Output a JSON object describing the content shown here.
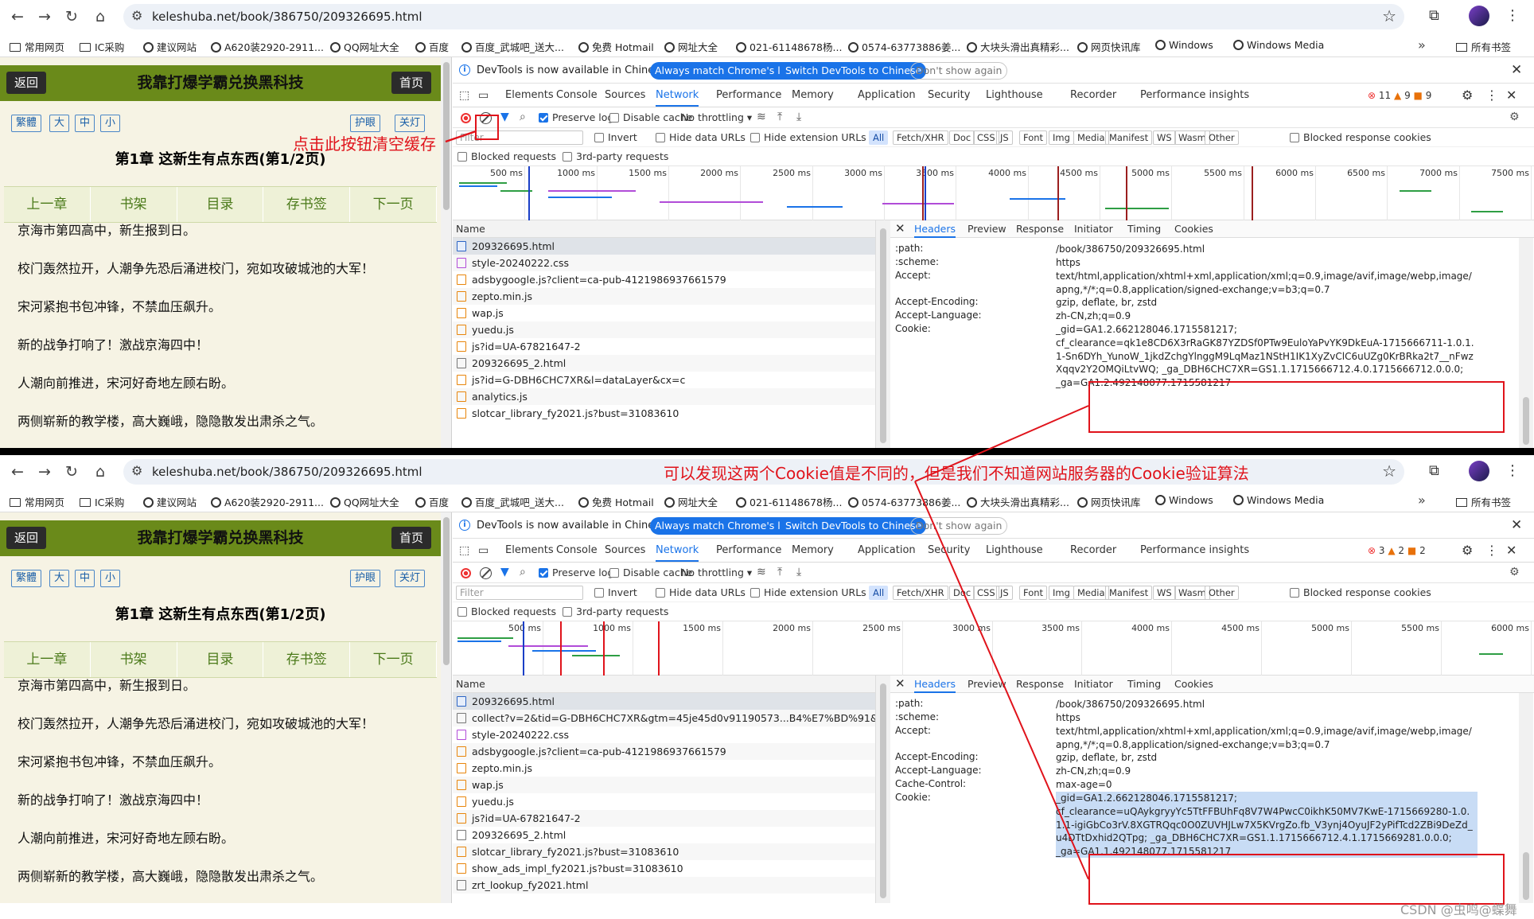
{
  "browser": {
    "url": "keleshuba.net/book/386750/209326695.html",
    "bookmarks": [
      "常用网页",
      "IC采购",
      "建议网站",
      "A620装2920-2911...",
      "QQ网址大全",
      "百度",
      "百度_武城吧_送大...",
      "免费 Hotmail",
      "网址大全",
      "021-61148678杨...",
      "0574-63773886姜...",
      "大块头滑出真精彩...",
      "网页快讯库",
      "Windows",
      "Windows Media"
    ],
    "all_bookmarks": "所有书签",
    "more": "»"
  },
  "reader": {
    "back_label": "返回",
    "home_label": "首页",
    "book_title": "我靠打爆学霸兑换黑科技",
    "font_buttons": [
      "繁體",
      "大",
      "中",
      "小"
    ],
    "eye_label": "护眼",
    "light_label": "关灯",
    "chapter_title": "第1章 这新生有点东西(第1/2页)",
    "chapter_nav": [
      "上一章",
      "书架",
      "目录",
      "存书签",
      "下一页"
    ],
    "paragraphs": [
      "京海市第四高中，新生报到日。",
      "校门轰然拉开，人潮争先恐后涌进校门，宛如攻破城池的大军！",
      "宋河紧抱书包冲锋，不禁血压飙升。",
      "新的战争打响了！激战京海四中！",
      "人潮向前推进，宋河好奇地左顾右盼。",
      "两侧崭新的教学楼，高大巍峨，隐隐散发出肃杀之气。"
    ]
  },
  "devtools": {
    "info_message": "DevTools is now available in Chinese!",
    "btn_match": "Always match Chrome's language",
    "btn_switch": "Switch DevTools to Chinese",
    "btn_dont_show": "Don't show again",
    "tabs": [
      "Elements",
      "Console",
      "Sources",
      "Network",
      "Performance",
      "Memory",
      "Application",
      "Security",
      "Lighthouse",
      "Recorder",
      "Performance insights"
    ],
    "active_tab": "Network",
    "toolbar": {
      "preserve_log": "Preserve log",
      "disable_cache": "Disable cache",
      "throttling": "No throttling"
    },
    "filter_placeholder": "Filter",
    "invert": "Invert",
    "hide_data_urls": "Hide data URLs",
    "hide_ext_urls": "Hide extension URLs",
    "types": [
      "All",
      "Fetch/XHR",
      "Doc",
      "CSS",
      "JS",
      "Font",
      "Img",
      "Media",
      "Manifest",
      "WS",
      "Wasm",
      "Other"
    ],
    "blocked_cookies": "Blocked response cookies",
    "blocked_requests": "Blocked requests",
    "third_party": "3rd-party requests",
    "name_header": "Name",
    "detail_tabs": [
      "Headers",
      "Preview",
      "Response",
      "Initiator",
      "Timing",
      "Cookies"
    ]
  },
  "shots": [
    {
      "badges": {
        "errors": "11",
        "warnings": "9",
        "issues": "9"
      },
      "ticks": [
        "500 ms",
        "1000 ms",
        "1500 ms",
        "2000 ms",
        "2500 ms",
        "3000 ms",
        "3500 ms",
        "4000 ms",
        "4500 ms",
        "5000 ms",
        "5500 ms",
        "6000 ms",
        "6500 ms",
        "7000 ms",
        "7500 ms"
      ],
      "requests": [
        {
          "name": "209326695.html",
          "kind": "doc"
        },
        {
          "name": "style-20240222.css",
          "kind": "css"
        },
        {
          "name": "adsbygoogle.js?client=ca-pub-4121986937661579",
          "kind": "js"
        },
        {
          "name": "zepto.min.js",
          "kind": "js"
        },
        {
          "name": "wap.js",
          "kind": "js"
        },
        {
          "name": "yuedu.js",
          "kind": "js"
        },
        {
          "name": "js?id=UA-67821647-2",
          "kind": "js"
        },
        {
          "name": "209326695_2.html",
          "kind": "blank"
        },
        {
          "name": "js?id=G-DBH6CHC7XR&l=dataLayer&cx=c",
          "kind": "js"
        },
        {
          "name": "analytics.js",
          "kind": "js"
        },
        {
          "name": "slotcar_library_fy2021.js?bust=31083610",
          "kind": "js"
        }
      ],
      "headers": [
        {
          "k": ":path:",
          "v": "/book/386750/209326695.html"
        },
        {
          "k": ":scheme:",
          "v": "https"
        },
        {
          "k": "Accept:",
          "v": "text/html,application/xhtml+xml,application/xml;q=0.9,image/avif,image/webp,image/apng,*/*;q=0.8,application/signed-exchange;v=b3;q=0.7"
        },
        {
          "k": "Accept-Encoding:",
          "v": "gzip, deflate, br, zstd"
        },
        {
          "k": "Accept-Language:",
          "v": "zh-CN,zh;q=0.9"
        },
        {
          "k": "Cookie:",
          "v": "_gid=GA1.2.662128046.1715581217;"
        },
        {
          "k": "",
          "v": "cf_clearance=qk1e8CD6X3rRaGK87YZDSf0PTw9EuloYaPvYK9DkEuA-1715666711-1.0.1.1-Sn6DYh_YunoW_1jkdZchgYlnggM9LqMaz1NStH1IK1XyZvClC6uUZg0KrBRka2t7__nFwzXqqv2Y2OMQiLtvWQ; _ga_DBH6CHC7XR=GS1.1.1715666712.4.0.1715666712.0.0.0;"
        },
        {
          "k": "",
          "v": "_ga=GA1.2.492148077.1715581217"
        }
      ]
    },
    {
      "badges": {
        "errors": "3",
        "warnings": "2",
        "issues": "2"
      },
      "ticks": [
        "500 ms",
        "1000 ms",
        "1500 ms",
        "2000 ms",
        "2500 ms",
        "3000 ms",
        "3500 ms",
        "4000 ms",
        "4500 ms",
        "5000 ms",
        "5500 ms",
        "6000 ms"
      ],
      "requests": [
        {
          "name": "209326695.html",
          "kind": "doc"
        },
        {
          "name": "collect?v=2&tid=G-DBH6CHC7XR&gtm=45je45d0v91190573...B4%E7%BD%91&en=u...",
          "kind": "blank"
        },
        {
          "name": "style-20240222.css",
          "kind": "css"
        },
        {
          "name": "adsbygoogle.js?client=ca-pub-4121986937661579",
          "kind": "js"
        },
        {
          "name": "zepto.min.js",
          "kind": "js"
        },
        {
          "name": "wap.js",
          "kind": "js"
        },
        {
          "name": "yuedu.js",
          "kind": "js"
        },
        {
          "name": "js?id=UA-67821647-2",
          "kind": "js"
        },
        {
          "name": "209326695_2.html",
          "kind": "blank"
        },
        {
          "name": "slotcar_library_fy2021.js?bust=31083610",
          "kind": "js"
        },
        {
          "name": "show_ads_impl_fy2021.js?bust=31083610",
          "kind": "js"
        },
        {
          "name": "zrt_lookup_fy2021.html",
          "kind": "blank"
        }
      ],
      "headers": [
        {
          "k": ":path:",
          "v": "/book/386750/209326695.html"
        },
        {
          "k": ":scheme:",
          "v": "https"
        },
        {
          "k": "Accept:",
          "v": "text/html,application/xhtml+xml,application/xml;q=0.9,image/avif,image/webp,image/apng,*/*;q=0.8,application/signed-exchange;v=b3;q=0.7"
        },
        {
          "k": "Accept-Encoding:",
          "v": "gzip, deflate, br, zstd"
        },
        {
          "k": "Accept-Language:",
          "v": "zh-CN,zh;q=0.9"
        },
        {
          "k": "Cache-Control:",
          "v": "max-age=0"
        },
        {
          "k": "Cookie:",
          "v": "_gid=GA1.2.662128046.1715581217;"
        },
        {
          "k": "",
          "v": "cf_clearance=uQAykgryyYc5TtFFBUhFq8V7W4PwcC0ikhK50MV7KwE-1715669280-1.0.1.1-igiGbCo3rV.8XGTRQqc0O0ZUVHJLw7X5KVrgZo.fb_V3ynj4OyuJF2yPifTcd2ZBi9DeZd_u4DTtDxhid2QTpg; _ga_DBH6CHC7XR=GS1.1.1715666712.4.1.1715669281.0.0.0;"
        },
        {
          "k": "",
          "v": "_ga=GA1.1.492148077.1715581217"
        }
      ]
    }
  ],
  "annotations": {
    "clear_note": "点击此按钮清空缓存",
    "cookie_note": "可以发现这两个Cookie值是不同的，但是我们不知道网站服务器的Cookie验证算法"
  },
  "watermark": "CSDN @虫鸣@蝶舞",
  "colors": {
    "annotation": "#e0131b",
    "header_band": "#6a8a1a",
    "devtools_active": "#1a73e8"
  }
}
